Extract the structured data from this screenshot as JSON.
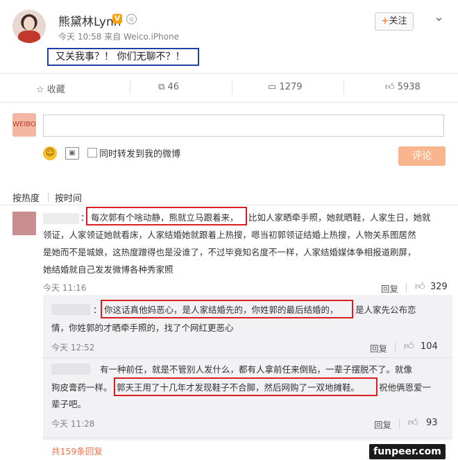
{
  "header": {
    "user_name": "熊黛林Lynn",
    "verified_badge": "V",
    "meta": "今天 10:58 来自 Weico.iPhone",
    "follow_label": "关注",
    "follow_plus": "+",
    "post_text": "又关我事？！ 你们无聊不？！"
  },
  "actions": {
    "favorite_label": "收藏",
    "repost_count": "46",
    "comment_count": "1279",
    "like_count": "5938"
  },
  "composer": {
    "avatar_text": "WEIBO",
    "checkbox_label": "同时转发到我的微博",
    "submit_label": "评论"
  },
  "sort_tabs": [
    "按热度",
    "按时间"
  ],
  "comments": [
    {
      "highlight": "每次郭有个啥动静，熊就立马跟着来，",
      "text_rest": "比如人家晒牵手照，她就晒鞋，人家生日，她就",
      "lines": [
        "领证，人家领证她就看床，人家结婚她就跟着上热搜，嗯当初郭领证结婚上热搜，人物关系图居然",
        "是她而不是城娘，这热度蹭得也是没谁了，不过毕竟知名度不一样，人家结婚媒体争相报道刷屏，",
        "她结婚就自己发发微博各种秀家照"
      ],
      "time": "今天 11:16",
      "reply": "回复",
      "likes": "329"
    },
    {
      "prefix": "：",
      "highlight": "你这话真他妈恶心，是人家结婚先的，你姓郭的最后结婚的，",
      "text_rest": "是人家先公布恋",
      "lines": [
        "情，你姓郭的才晒牵手照的，找了个网红更恶心"
      ],
      "time": "今天 12:52",
      "reply": "回复",
      "likes": "104"
    },
    {
      "text_first": "有一种前任，就是不管别人发什么，都有人拿前任来倒贴，一辈子摆脱不了。就像",
      "text_pre": "狗皮膏药一样。",
      "highlight": "郭天王用了十几年才发现鞋子不合脚，然后网购了一双地摊鞋。",
      "text_rest": "祝他俩恩爱一",
      "lines": [
        "辈子吧。"
      ],
      "time": "今天 11:28",
      "reply": "回复",
      "likes": "93"
    }
  ],
  "more_link": "共159条回复",
  "watermark": "funpeer.com",
  "colors": {
    "highlight_border": "#d81e1e",
    "post_border": "#1f3fa6",
    "accent": "#ff8140"
  }
}
